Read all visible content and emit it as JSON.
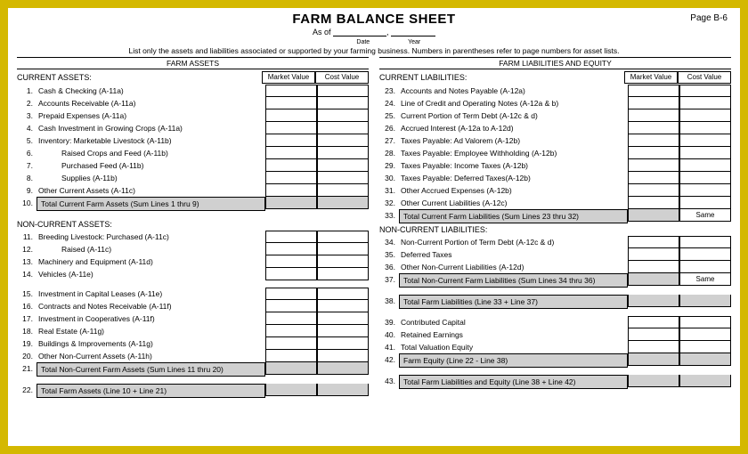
{
  "title": "FARM BALANCE SHEET",
  "page": "Page B-6",
  "asof": "As of",
  "date_lbl": "Date",
  "year_lbl": "Year",
  "subtitle": "List only the assets and liabilities associated or supported by your farming business.  Numbers in parentheses refer to page numbers for asset lists.",
  "mv": "Market Value",
  "cv": "Cost Value",
  "same": "Same",
  "left": {
    "h": "FARM ASSETS",
    "ca": "CURRENT ASSETS:",
    "r": [
      {
        "n": "1.",
        "l": "Cash & Checking (A-11a)"
      },
      {
        "n": "2.",
        "l": "Accounts Receivable (A-11a)"
      },
      {
        "n": "3.",
        "l": "Prepaid Expenses (A-11a)"
      },
      {
        "n": "4.",
        "l": "Cash Investment in Growing Crops (A-11a)"
      },
      {
        "n": "5.",
        "l": "Inventory:  Marketable Livestock (A-11b)"
      },
      {
        "n": "6.",
        "l": "Raised Crops and Feed (A-11b)",
        "in": 1
      },
      {
        "n": "7.",
        "l": "Purchased Feed (A-11b)",
        "in": 1
      },
      {
        "n": "8.",
        "l": "Supplies (A-11b)",
        "in": 1
      },
      {
        "n": "9.",
        "l": "Other Current Assets (A-11c)"
      }
    ],
    "t1": {
      "n": "10.",
      "l": "Total Current Farm Assets (Sum Lines 1 thru 9)"
    },
    "nca": "NON-CURRENT ASSETS:",
    "r2": [
      {
        "n": "11.",
        "l": "Breeding Livestock:       Purchased (A-11c)"
      },
      {
        "n": "12.",
        "l": "Raised (A-11c)",
        "in": 1
      },
      {
        "n": "13.",
        "l": "Machinery and Equipment (A-11d)"
      },
      {
        "n": "14.",
        "l": "Vehicles (A-11e)"
      }
    ],
    "r3": [
      {
        "n": "15.",
        "l": "Investment in Capital Leases (A-11e)"
      },
      {
        "n": "16.",
        "l": "Contracts and Notes Receivable (A-11f)"
      },
      {
        "n": "17.",
        "l": "Investment in Cooperatives (A-11f)"
      },
      {
        "n": "18.",
        "l": "Real Estate (A-11g)"
      },
      {
        "n": "19.",
        "l": "Buildings & Improvements (A-11g)"
      },
      {
        "n": "20.",
        "l": "Other Non-Current Assets (A-11h)"
      }
    ],
    "t2": {
      "n": "21.",
      "l": "Total Non-Current Farm Assets (Sum Lines 11 thru 20)"
    },
    "t3": {
      "n": "22.",
      "l": "Total Farm Assets (Line 10 + Line 21)"
    }
  },
  "right": {
    "h": "FARM LIABILITIES AND EQUITY",
    "cl": "CURRENT LIABILITIES:",
    "r": [
      {
        "n": "23.",
        "l": "Accounts and Notes Payable (A-12a)"
      },
      {
        "n": "24.",
        "l": "Line of Credit and Operating Notes (A-12a & b)"
      },
      {
        "n": "25.",
        "l": "Current Portion of Term Debt (A-12c & d)"
      },
      {
        "n": "26.",
        "l": "Accrued Interest (A-12a to A-12d)"
      },
      {
        "n": "27.",
        "l": "Taxes Payable:  Ad Valorem (A-12b)"
      },
      {
        "n": "28.",
        "l": "Taxes Payable:  Employee Withholding (A-12b)"
      },
      {
        "n": "29.",
        "l": "Taxes Payable:  Income Taxes (A-12b)"
      },
      {
        "n": "30.",
        "l": "Taxes Payable:  Deferred Taxes(A-12b)"
      },
      {
        "n": "31.",
        "l": "Other Accrued Expenses (A-12b)"
      },
      {
        "n": "32.",
        "l": "Other Current Liabilities (A-12c)"
      }
    ],
    "t1": {
      "n": "33.",
      "l": "Total Current Farm Liabilities (Sum Lines 23 thru 32)"
    },
    "ncl": "NON-CURRENT LIABILITIES:",
    "r2": [
      {
        "n": "34.",
        "l": "Non-Current Portion of Term Debt (A-12c & d)"
      },
      {
        "n": "35.",
        "l": "Deferred Taxes"
      },
      {
        "n": "36.",
        "l": "Other Non-Current Liabilities (A-12d)"
      }
    ],
    "t2": {
      "n": "37.",
      "l": "Total Non-Current Farm Liabilities  (Sum Lines 34 thru 36)"
    },
    "t3": {
      "n": "38.",
      "l": "Total Farm Liabilities  (Line 33 + Line 37)"
    },
    "r3": [
      {
        "n": "39.",
        "l": "Contributed Capital"
      },
      {
        "n": "40.",
        "l": "Retained Earnings"
      },
      {
        "n": "41.",
        "l": "Total Valuation Equity"
      }
    ],
    "t4": {
      "n": "42.",
      "l": "Farm Equity (Line 22 - Line 38)"
    },
    "t5": {
      "n": "43.",
      "l": "Total Farm Liabilities and Equity (Line 38 + Line 42)"
    }
  }
}
